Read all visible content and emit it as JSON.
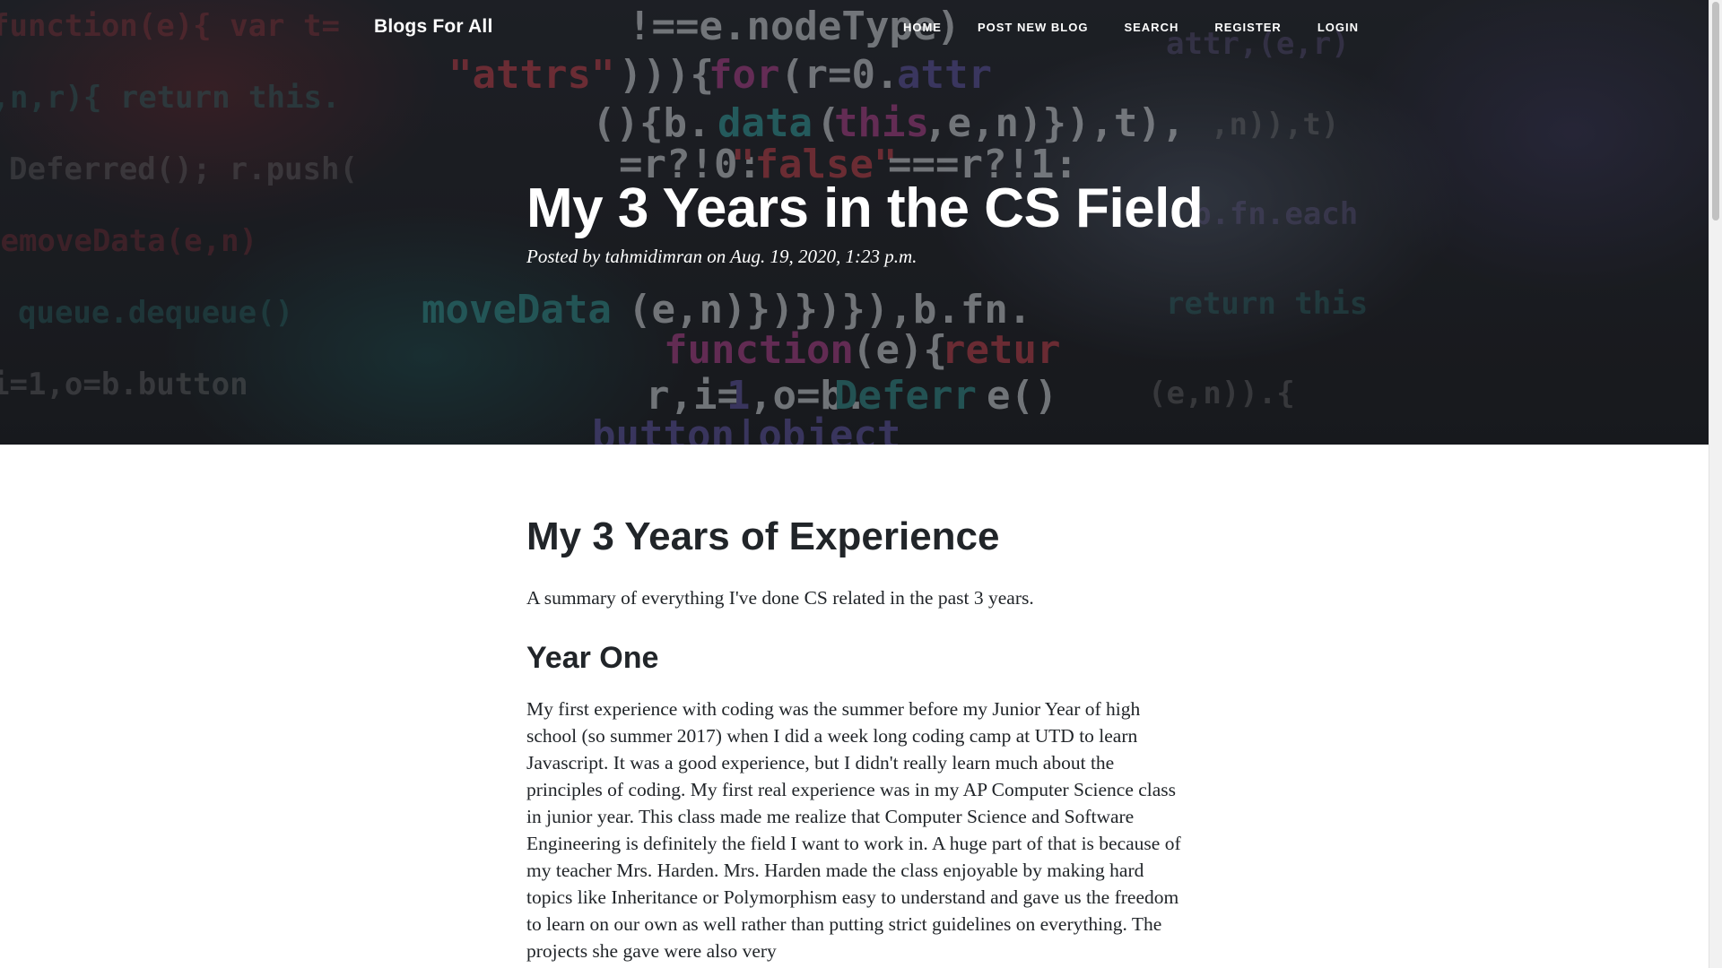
{
  "nav": {
    "brand": "Blogs For All",
    "links": [
      {
        "label": "HOME"
      },
      {
        "label": "POST NEW BLOG"
      },
      {
        "label": "SEARCH"
      },
      {
        "label": "REGISTER"
      },
      {
        "label": "LOGIN"
      }
    ]
  },
  "post": {
    "title": "My 3 Years in the CS Field",
    "meta_prefix": "Posted by",
    "author": "tahmidimran",
    "meta_on": "on",
    "date": "Aug. 19, 2020, 1:23 p.m."
  },
  "article": {
    "heading": "My 3 Years of Experience",
    "summary": "A summary of everything I've done CS related in the past 3 years.",
    "section_title": "Year One",
    "section_body": "My first experience with coding was the summer before my Junior Year of high school (so summer 2017) when I did a week long coding camp at UTD to learn Javascript. It was a good experience, but I didn't really learn much about the principles of coding. My first real experience was in my AP Computer Science class in junior year. This class made me realize that Computer Science and Software Engineering is definitely the field I want to work in. A huge part of that is because of my teacher Mrs. Harden. Mrs. Harden made the class enjoyable by making hard topics like Inheritance or Polymorphism easy to understand and gave us the freedom to learn on our own as well rather than putting strict guidelines on everything. The projects she gave were also very"
  }
}
